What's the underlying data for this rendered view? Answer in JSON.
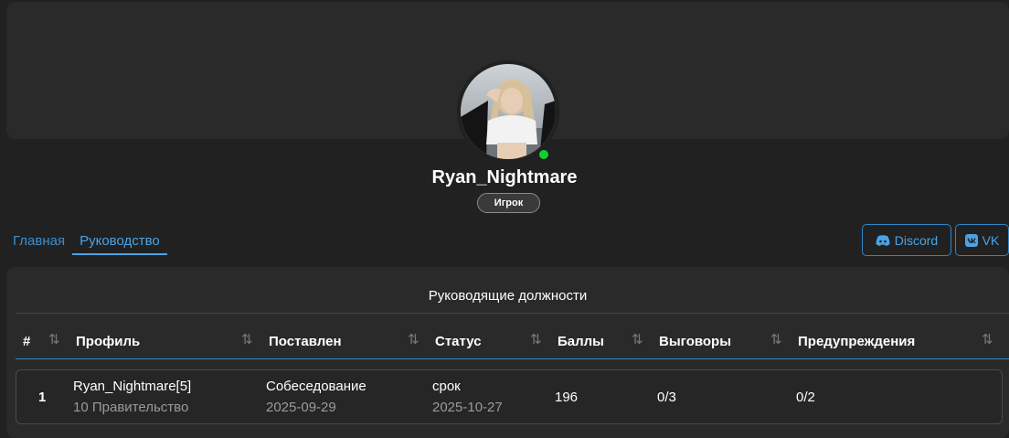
{
  "profile": {
    "username": "Ryan_Nightmare",
    "role": "Игрок",
    "online_color": "#10d030"
  },
  "tabs": [
    {
      "label": "Главная",
      "active": false
    },
    {
      "label": "Руководство",
      "active": true
    }
  ],
  "social": {
    "discord_label": "Discord",
    "vk_label": "VK",
    "discord_icon": "discord-icon",
    "vk_icon": "vk-icon"
  },
  "panel": {
    "title": "Руководящие должности",
    "columns": [
      "#",
      "Профиль",
      "Поставлен",
      "Статус",
      "Баллы",
      "Выговоры",
      "Предупреждения"
    ],
    "rows": [
      {
        "index": "1",
        "profile_name": "Ryan_Nightmare[5]",
        "profile_sub": "10 Правительство",
        "placed": "Собеседование",
        "placed_date": "2025-09-29",
        "status": "срок",
        "status_date": "2025-10-27",
        "points": "196",
        "reprimands": "0/3",
        "warnings": "0/2"
      }
    ]
  },
  "colors": {
    "accent": "#4aa3e6",
    "background": "#212121",
    "surface": "#2a2a2a"
  }
}
